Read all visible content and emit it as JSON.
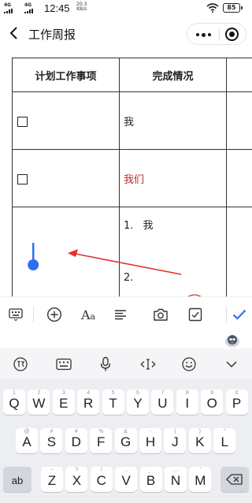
{
  "status": {
    "sig1": "4G",
    "sig2": "4G",
    "time": "12:45",
    "netspeed_value": "20.3",
    "netspeed_unit": "KB/s",
    "battery": "85"
  },
  "nav": {
    "title": "工作周报"
  },
  "table": {
    "headers": [
      "计划工作事项",
      "完成情况"
    ],
    "rows": [
      {
        "done": "我",
        "done_color": "#222222"
      },
      {
        "done": "我们",
        "done_color": "#c0282d"
      }
    ],
    "last_row_list": [
      {
        "num": "1.",
        "text": "我"
      },
      {
        "num": "2.",
        "text": ""
      }
    ]
  },
  "annotation_color": "#e0312b",
  "cursor_color": "#2f6ef2",
  "check_color": "#2f6ef2",
  "keyboard": {
    "row1": [
      {
        "l": "Q",
        "s": "1"
      },
      {
        "l": "W",
        "s": "2"
      },
      {
        "l": "E",
        "s": "3"
      },
      {
        "l": "R",
        "s": "4"
      },
      {
        "l": "T",
        "s": "5"
      },
      {
        "l": "Y",
        "s": "6"
      },
      {
        "l": "U",
        "s": "7"
      },
      {
        "l": "I",
        "s": "8"
      },
      {
        "l": "O",
        "s": "9"
      },
      {
        "l": "P",
        "s": "0"
      }
    ],
    "row2": [
      {
        "l": "A",
        "s": "@"
      },
      {
        "l": "S",
        "s": "#"
      },
      {
        "l": "D",
        "s": "¥"
      },
      {
        "l": "F",
        "s": "%"
      },
      {
        "l": "G",
        "s": "&"
      },
      {
        "l": "H",
        "s": "-"
      },
      {
        "l": "J",
        "s": "("
      },
      {
        "l": "K",
        "s": ")"
      },
      {
        "l": "L",
        "s": "\""
      }
    ],
    "row3": [
      {
        "l": "Z",
        "s": "~"
      },
      {
        "l": "X",
        "s": "?"
      },
      {
        "l": "C",
        "s": "!"
      },
      {
        "l": "V",
        "s": ","
      },
      {
        "l": "B",
        "s": "、"
      },
      {
        "l": "N",
        "s": "…"
      },
      {
        "l": "M",
        "s": "'"
      }
    ],
    "ab_label": "ab"
  }
}
